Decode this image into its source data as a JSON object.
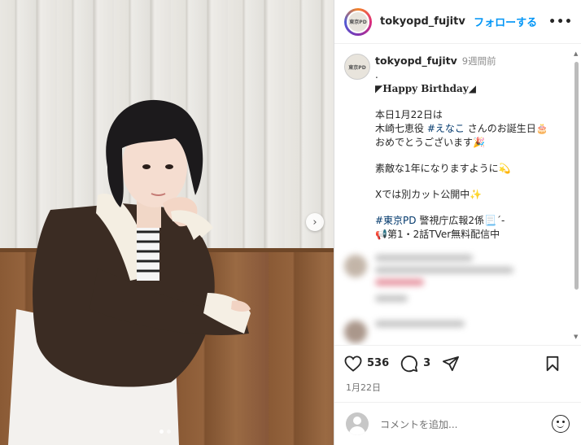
{
  "post": {
    "username": "tokyopd_fujitv",
    "follow_label": "フォローする",
    "more_label": "•••",
    "avatar_text": "東京PD"
  },
  "caption": {
    "username": "tokyopd_fujitv",
    "time": "9週間前",
    "lines": {
      "dot": ".",
      "title": "◤Happy Birthday◢",
      "l1": "本日1月22日は",
      "l2_pre": "木崎七恵役 ",
      "l2_tag": "#えなこ",
      "l2_post": " さんのお誕生日🎂",
      "l3": "おめでとうございます🎉",
      "l4": "素敵な1年になりますように💫",
      "l5": "Xでは別カット公開中✨",
      "l6_tag": "#東京PD",
      "l6_post": " 警視庁広報2係📃ˊ-",
      "l7": "📢第1・2話TVer無料配信中"
    }
  },
  "actions": {
    "likes": "536",
    "comments": "3"
  },
  "date": "1月22日",
  "comment_input": {
    "placeholder": "コメントを追加..."
  },
  "carousel": {
    "next_label": "›"
  },
  "colors": {
    "follow": "#0095f6",
    "hashtag": "#00376b",
    "muted": "#8e8e8e"
  }
}
